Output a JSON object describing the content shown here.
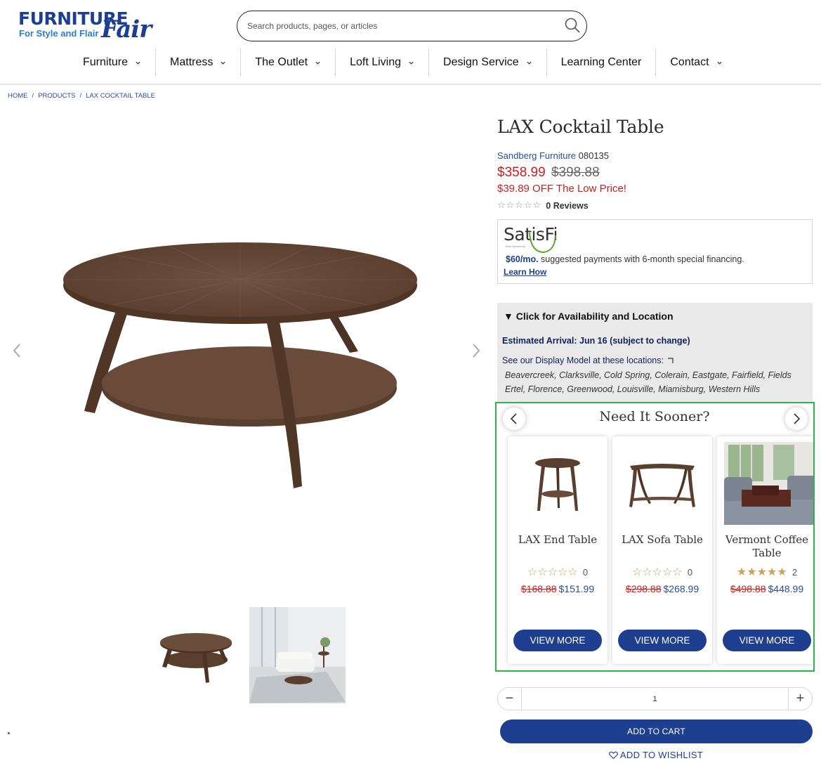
{
  "header": {
    "logo_word1": "FURNITURE",
    "logo_tagline": "For Style and Flair",
    "logo_word2": "Fair",
    "search_placeholder": "Search products, pages, or articles"
  },
  "nav": [
    {
      "label": "Furniture",
      "has_dropdown": true
    },
    {
      "label": "Mattress",
      "has_dropdown": true
    },
    {
      "label": "The Outlet",
      "has_dropdown": true
    },
    {
      "label": "Loft Living",
      "has_dropdown": true
    },
    {
      "label": "Design Service",
      "has_dropdown": true
    },
    {
      "label": "Learning Center",
      "has_dropdown": false
    },
    {
      "label": "Contact",
      "has_dropdown": true
    }
  ],
  "breadcrumb": [
    "HOME",
    "PRODUCTS",
    "LAX COCKTAIL TABLE"
  ],
  "breadcrumb_sep": "/",
  "product": {
    "title": "LAX Cocktail Table",
    "brand": "Sandberg Furniture",
    "sku": "080135",
    "sale_price": "$358.99",
    "original_price": "$398.88",
    "discount_text": "$39.89 OFF The Low Price!",
    "reviews_text": "0 Reviews"
  },
  "financing": {
    "logo": "SatisFi",
    "logo_sub": "from Synchrony",
    "monthly": "$60/mo.",
    "text": " suggested payments with 6-month special financing.",
    "link": "Learn How"
  },
  "availability": {
    "heading": "Click for Availability and Location",
    "arrival": "Estimated Arrival: Jun 16 (subject to change)",
    "display_label": "See our Display Model at these locations:",
    "locations": "Beavercreek, Clarksville, Cold Spring, Colerain, Eastgate, Fairfield, Fields Ertel, Florence, Greenwood, Louisville, Miamisburg, Western Hills"
  },
  "sooner": {
    "title": "Need It Sooner?",
    "button_label": "VIEW MORE",
    "items": [
      {
        "name": "LAX End Table",
        "rating": 0,
        "reviews": "0",
        "old_price": "$168.88",
        "price": "$151.99"
      },
      {
        "name": "LAX Sofa Table",
        "rating": 0,
        "reviews": "0",
        "old_price": "$298.88",
        "price": "$268.99"
      },
      {
        "name": "Vermont Coffee Table",
        "rating": 4.5,
        "reviews": "2",
        "old_price": "$498.88",
        "price": "$448.99"
      }
    ]
  },
  "cart": {
    "quantity": "1",
    "add_to_cart": "ADD TO CART",
    "add_to_wishlist": "ADD TO WISHLIST"
  },
  "colors": {
    "brand_blue": "#1e3f8f",
    "sale_red": "#c81e1e",
    "highlight_green": "#2db34a",
    "star_gold": "#c8a35a"
  }
}
